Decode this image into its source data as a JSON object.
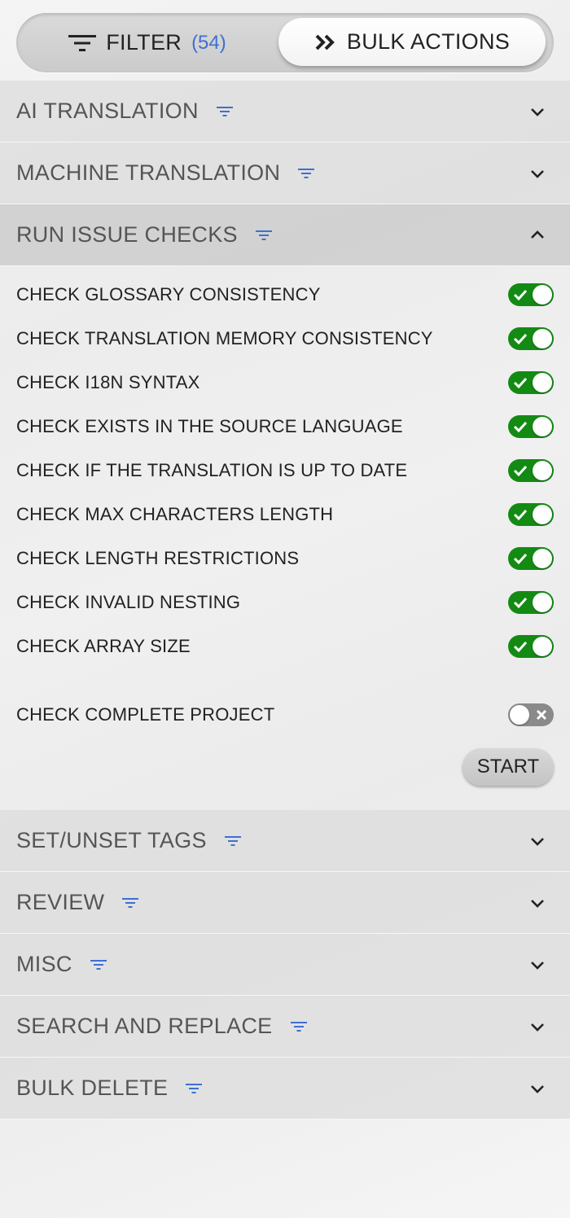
{
  "topbar": {
    "filter_label": "FILTER",
    "filter_count": "(54)",
    "bulk_label": "BULK ACTIONS"
  },
  "sections": {
    "ai_translation": "AI TRANSLATION",
    "machine_translation": "MACHINE TRANSLATION",
    "run_issue_checks": "RUN ISSUE CHECKS",
    "set_unset_tags": "SET/UNSET TAGS",
    "review": "REVIEW",
    "misc": "MISC",
    "search_and_replace": "SEARCH AND REPLACE",
    "bulk_delete": "BULK DELETE"
  },
  "checks": [
    {
      "label": "CHECK GLOSSARY CONSISTENCY",
      "enabled": true
    },
    {
      "label": "CHECK TRANSLATION MEMORY CONSISTENCY",
      "enabled": true
    },
    {
      "label": "CHECK I18N SYNTAX",
      "enabled": true
    },
    {
      "label": "CHECK EXISTS IN THE SOURCE LANGUAGE",
      "enabled": true
    },
    {
      "label": "CHECK IF THE TRANSLATION IS UP TO DATE",
      "enabled": true
    },
    {
      "label": "CHECK MAX CHARACTERS LENGTH",
      "enabled": true
    },
    {
      "label": "CHECK LENGTH RESTRICTIONS",
      "enabled": true
    },
    {
      "label": "CHECK INVALID NESTING",
      "enabled": true
    },
    {
      "label": "CHECK ARRAY SIZE",
      "enabled": true
    }
  ],
  "complete_project": {
    "label": "CHECK COMPLETE PROJECT",
    "enabled": false
  },
  "start_label": "START",
  "colors": {
    "toggle_on": "#138a13",
    "toggle_off": "#8a8a8a",
    "accent_blue": "#3f6fd1"
  }
}
